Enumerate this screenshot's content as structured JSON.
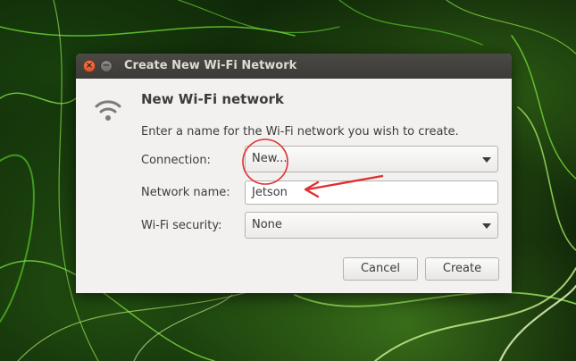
{
  "window": {
    "title": "Create New Wi-Fi Network",
    "close_symbol": "×",
    "minimize_symbol": "−"
  },
  "dialog": {
    "heading": "New Wi-Fi network",
    "description": "Enter a name for the Wi-Fi network you wish to create.",
    "icon": "wifi-icon",
    "connection": {
      "label": "Connection:",
      "value": "New..."
    },
    "network_name": {
      "label": "Network name:",
      "value": "Jetson"
    },
    "security": {
      "label": "Wi-Fi security:",
      "value": "None"
    },
    "buttons": {
      "cancel": "Cancel",
      "create": "Create"
    }
  },
  "annotation_colors": {
    "circle": "#e03030",
    "arrow": "#e03030"
  },
  "colors": {
    "close_button": "#e9603a",
    "titlebar": "#3c3b37",
    "dialog_bg": "#f2f1f0"
  }
}
